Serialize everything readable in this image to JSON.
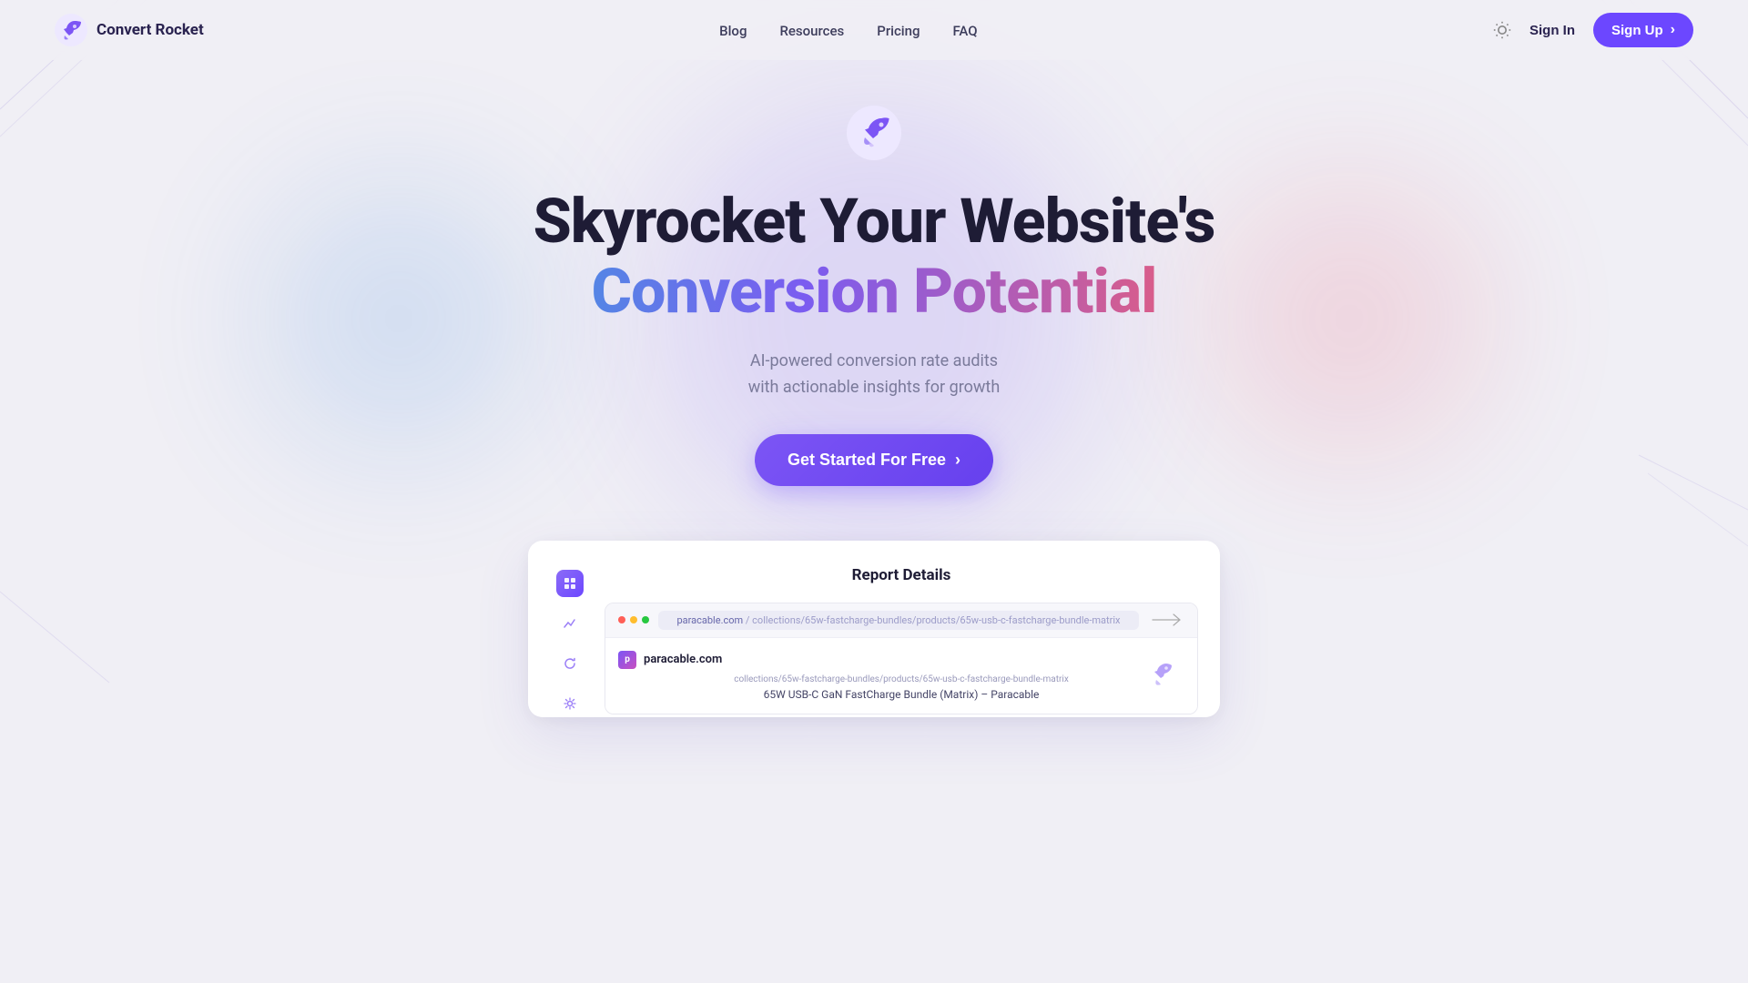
{
  "brand": {
    "name": "Convert Rocket",
    "logo_alt": "rocket icon"
  },
  "nav": {
    "links": [
      {
        "label": "Blog",
        "href": "#"
      },
      {
        "label": "Resources",
        "href": "#"
      },
      {
        "label": "Pricing",
        "href": "#"
      },
      {
        "label": "FAQ",
        "href": "#"
      }
    ],
    "sign_in": "Sign In",
    "sign_up": "Sign Up"
  },
  "hero": {
    "title_line1": "Skyrocket Your Website's",
    "title_line2": "Conversion Potential",
    "subtitle_line1": "AI-powered conversion rate audits",
    "subtitle_line2": "with actionable insights for growth",
    "cta_label": "Get Started For Free"
  },
  "dashboard": {
    "title": "Report Details",
    "browser": {
      "url": "paracable.com",
      "url_path": "collections/65w-fastcharge-bundles/products/65w-usb-c-fastcharge-bundle-matrix",
      "site_name": "paracable.com",
      "page_title": "65W USB-C GaN FastCharge Bundle (Matrix) – Paracable"
    }
  },
  "colors": {
    "accent": "#6c47ff",
    "gradient_from": "#4a90e2",
    "gradient_mid": "#7b5cf0",
    "gradient_to": "#e85d7a",
    "bg": "#f0eff5",
    "text_dark": "#1e1c35",
    "text_muted": "#7a7a9a"
  }
}
